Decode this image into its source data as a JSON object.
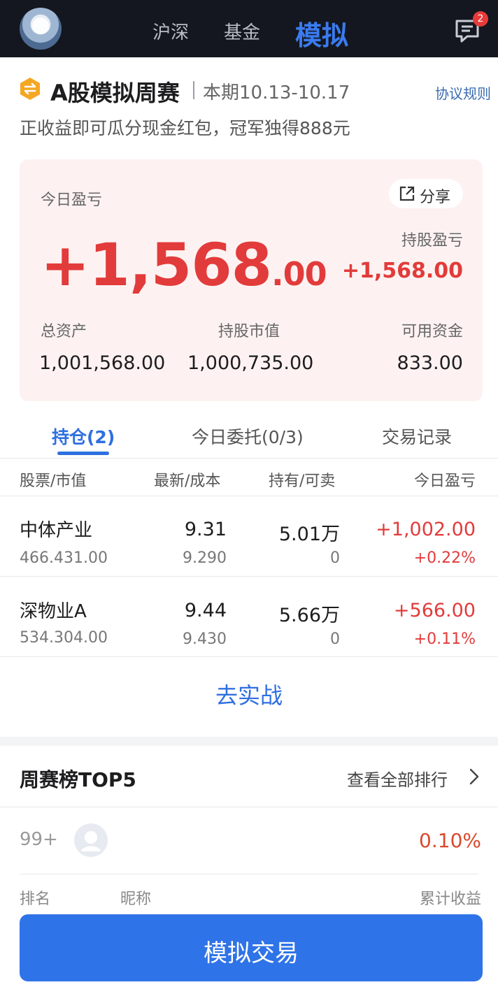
{
  "nav": {
    "tabs": [
      "沪深",
      "基金",
      "模拟"
    ],
    "active_tab": "模拟",
    "message_badge": "2"
  },
  "header": {
    "title": "A股模拟周赛",
    "period": "本期10.13-10.17",
    "rules_link": "协议规则",
    "subtitle": "正收益即可瓜分现金红包，冠军独得888元"
  },
  "pnl_card": {
    "today_label": "今日盈亏",
    "share_label": "分享",
    "today_pnl_int": "+1,568",
    "today_pnl_dec": ".00",
    "holding_pnl_label": "持股盈亏",
    "holding_pnl": "+1,568.00",
    "total_assets_label": "总资产",
    "total_assets": "1,001,568.00",
    "market_value_label": "持股市值",
    "market_value": "1,000,735.00",
    "available_label": "可用资金",
    "available": "833.00"
  },
  "tabs": [
    "持仓(2)",
    "今日委托(0/3)",
    "交易记录"
  ],
  "table": {
    "headers": [
      "股票/市值",
      "最新/成本",
      "持有/可卖",
      "今日盈亏"
    ],
    "rows": [
      {
        "name": "中体产业",
        "market_value": "466.431.00",
        "latest": "9.31",
        "cost": "9.290",
        "hold": "5.01万",
        "sellable": "0",
        "pnl": "+1,002.00",
        "pnl_pct": "+0.22%"
      },
      {
        "name": "深物业A",
        "market_value": "534.304.00",
        "latest": "9.44",
        "cost": "9.430",
        "hold": "5.66万",
        "sellable": "0",
        "pnl": "+566.00",
        "pnl_pct": "+0.11%"
      }
    ]
  },
  "go_trade": "去实战",
  "ranking": {
    "title": "周赛榜TOP5",
    "view_all": "查看全部排行",
    "my_rank": "99+",
    "my_return": "0.10%",
    "col_rank": "排名",
    "col_nick": "昵称",
    "col_return": "累计收益"
  },
  "bottom_button": "模拟交易",
  "colors": {
    "accent": "#2f73e8",
    "profit": "#e23b3b",
    "topbar": "#14171f"
  }
}
